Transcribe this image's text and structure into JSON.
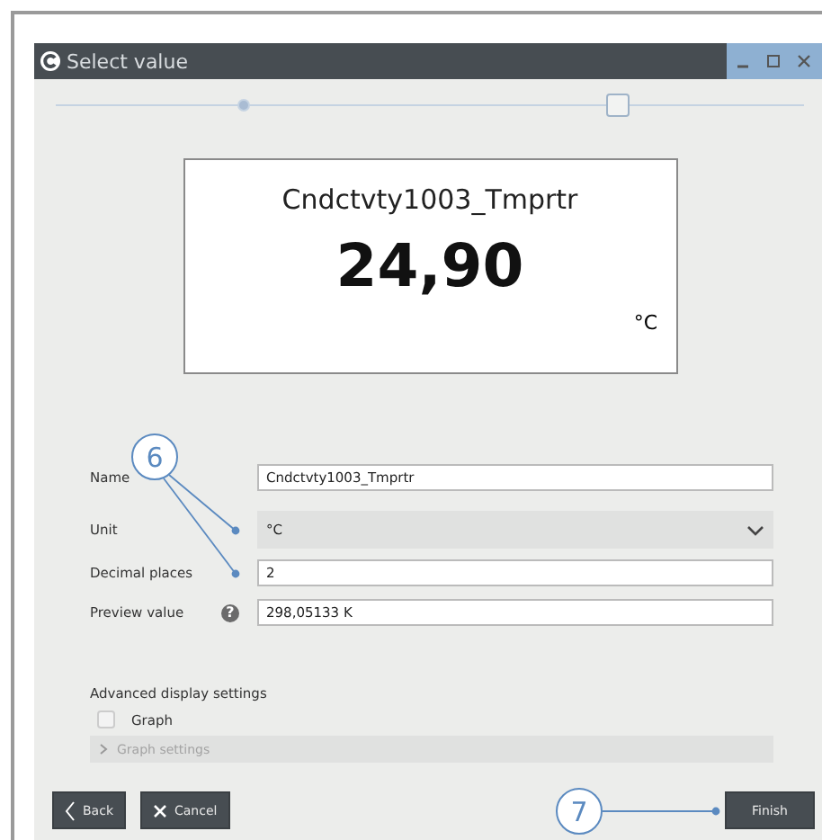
{
  "window": {
    "title": "Select value"
  },
  "steps": [
    {
      "selected": true
    },
    {
      "selected": false
    }
  ],
  "preview": {
    "name": "Cndctvty1003_Tmprtr",
    "value": "24,90",
    "unit": "°C"
  },
  "fields": [
    {
      "kind": "text",
      "label": "Name",
      "value": "Cndctvty1003_Tmprtr"
    },
    {
      "kind": "dropdown",
      "label": "Unit",
      "value": "°C"
    },
    {
      "kind": "text",
      "label": "Decimal places",
      "value": "2"
    },
    {
      "kind": "help",
      "label": "Preview value",
      "help": "?",
      "value": "298,05133 K"
    }
  ],
  "advanced": {
    "title": "Advanced display settings",
    "graph": {
      "label": "Graph",
      "checked": false
    },
    "graph_settings": {
      "label": "Graph settings",
      "expanded": false,
      "disabled": true
    }
  },
  "buttons": {
    "back": "Back",
    "cancel": "Cancel",
    "finish": "Finish"
  },
  "callouts": [
    {
      "label": "6"
    },
    {
      "label": "7"
    }
  ]
}
